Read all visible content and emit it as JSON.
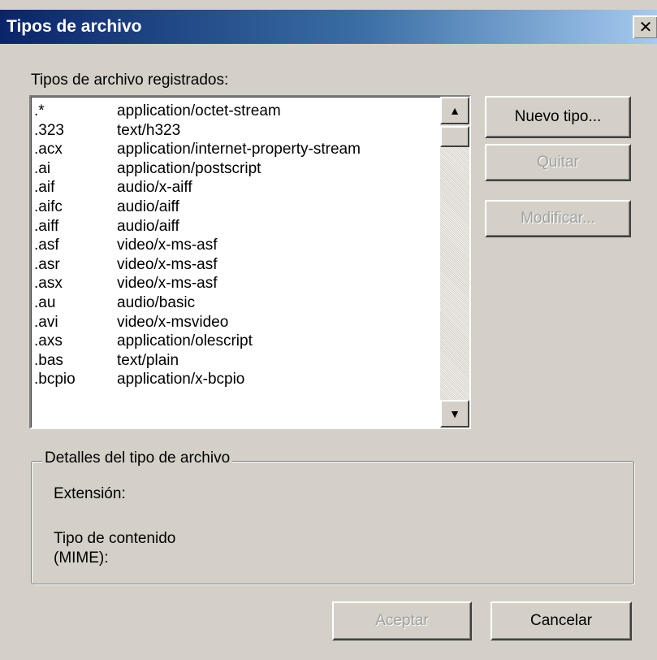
{
  "window": {
    "title": "Tipos de archivo",
    "close_glyph": "✕"
  },
  "list": {
    "label": "Tipos de archivo registrados:",
    "rows": [
      {
        "ext": ".*",
        "mime": "application/octet-stream"
      },
      {
        "ext": ".323",
        "mime": "text/h323"
      },
      {
        "ext": ".acx",
        "mime": "application/internet-property-stream"
      },
      {
        "ext": ".ai",
        "mime": "application/postscript"
      },
      {
        "ext": ".aif",
        "mime": "audio/x-aiff"
      },
      {
        "ext": ".aifc",
        "mime": "audio/aiff"
      },
      {
        "ext": ".aiff",
        "mime": "audio/aiff"
      },
      {
        "ext": ".asf",
        "mime": "video/x-ms-asf"
      },
      {
        "ext": ".asr",
        "mime": "video/x-ms-asf"
      },
      {
        "ext": ".asx",
        "mime": "video/x-ms-asf"
      },
      {
        "ext": ".au",
        "mime": "audio/basic"
      },
      {
        "ext": ".avi",
        "mime": "video/x-msvideo"
      },
      {
        "ext": ".axs",
        "mime": "application/olescript"
      },
      {
        "ext": ".bas",
        "mime": "text/plain"
      },
      {
        "ext": ".bcpio",
        "mime": "application/x-bcpio"
      }
    ],
    "scroll_up_glyph": "▲",
    "scroll_down_glyph": "▼"
  },
  "buttons": {
    "new_type": "Nuevo tipo...",
    "remove": "Quitar",
    "modify": "Modificar...",
    "accept": "Aceptar",
    "cancel": "Cancelar"
  },
  "details": {
    "group_title": "Detalles del tipo de archivo",
    "extension_label": "Extensión:",
    "content_type_label_line1": "Tipo de contenido",
    "content_type_label_line2": "(MIME):"
  }
}
